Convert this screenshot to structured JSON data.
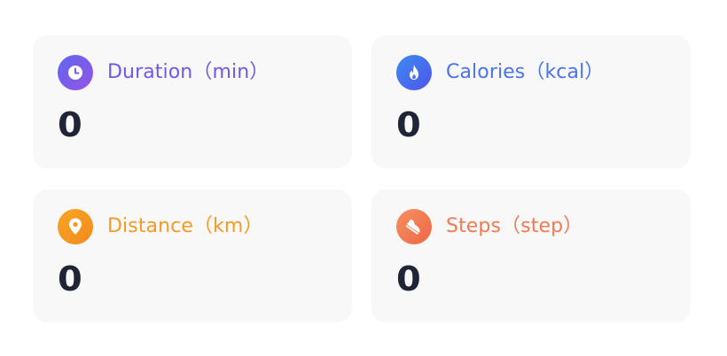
{
  "stats": [
    {
      "label": "Duration（min）",
      "value": "0",
      "icon": "clock-icon",
      "color": "#6F59EA",
      "icon_gradient": [
        "#5E67F0",
        "#9653E6"
      ]
    },
    {
      "label": "Calories（kcal）",
      "value": "0",
      "icon": "flame-icon",
      "color": "#4A73F0",
      "icon_gradient": [
        "#3E8BF4",
        "#4F54E8"
      ]
    },
    {
      "label": "Distance（km）",
      "value": "0",
      "icon": "location-pin-icon",
      "color": "#F49A24",
      "icon_gradient": [
        "#F7A524",
        "#F28A1D"
      ]
    },
    {
      "label": "Steps（step）",
      "value": "0",
      "icon": "shoe-icon",
      "color": "#F27A52",
      "icon_gradient": [
        "#F79060",
        "#EE6745"
      ]
    }
  ]
}
